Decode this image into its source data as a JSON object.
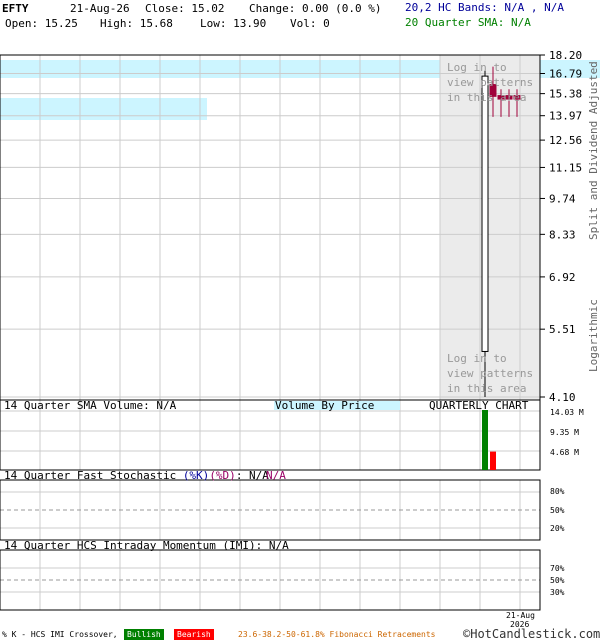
{
  "header": {
    "symbol": "EFTY",
    "date": "21-Aug-26",
    "close_text": "Close: 15.02",
    "change_text": "Change: 0.00 (0.0 %)",
    "open_text": "Open: 15.25",
    "high_text": "High: 15.68",
    "low_text": "Low: 13.90",
    "vol_text": "Vol: 0",
    "bands_text": "20,2 HC Bands: N/A , N/A",
    "sma_text": "20 Quarter SMA: N/A"
  },
  "side_labels": {
    "split": "Split and Dividend Adjusted",
    "log": "Logarithmic"
  },
  "patterns_text": [
    "Log in to",
    "view patterns",
    "in this area"
  ],
  "volume_panel": {
    "title": "14 Quarter SMA Volume: N/A",
    "vbp": "Volume By Price",
    "chart_label": "QUARTERLY CHART",
    "ticks": [
      "14.03 M",
      "9.35 M",
      "4.68 M"
    ]
  },
  "stoch_panel": {
    "title": "14 Quarter Fast Stochastic ",
    "k": "(%K)",
    "d": "(%D)",
    "vals": ": N/A",
    "vals2": "N/A",
    "ticks": [
      "80%",
      "50%",
      "20%"
    ]
  },
  "imi_panel": {
    "title": "14 Quarter HCS Intraday Momentum (IMI): N/A",
    "ticks": [
      "70%",
      "50%",
      "30%"
    ]
  },
  "footer": {
    "crossover": "% K - HCS IMI Crossover,",
    "bullish": "Bullish",
    "bearish": "Bearish",
    "fib": "23.6-38.2-50-61.8% Fibonacci Retracements",
    "copyright": "©HotCandlestick.com",
    "xdate1": "21-Aug",
    "xdate2": "2026"
  },
  "colors": {
    "up": "#ffffff",
    "down": "#a0003a",
    "vol_up": "#008000",
    "vol_down": "#ff0000",
    "band_fill": "#ccf5ff",
    "pattern_shade": "#ebebeb",
    "grid": "#cccccc",
    "blue_text": "#000099",
    "green_text": "#008000",
    "bullish_bg": "#008000",
    "bearish_bg": "#ff0000",
    "fib_text": "#cc6600"
  },
  "chart_data": {
    "type": "candlestick",
    "price_axis": {
      "scale": "log",
      "ticks": [
        "18.20",
        "16.79",
        "15.38",
        "13.97",
        "12.56",
        "11.15",
        "9.74",
        "8.33",
        "6.92",
        "5.51",
        "4.10"
      ]
    },
    "candles": [
      {
        "open": 5.0,
        "high": 17.0,
        "low": 4.1,
        "close": 16.6,
        "direction": "up"
      },
      {
        "open": 16.0,
        "high": 17.3,
        "low": 13.9,
        "close": 15.2,
        "direction": "down"
      },
      {
        "open": 15.25,
        "high": 15.68,
        "low": 13.9,
        "close": 15.02,
        "direction": "down"
      },
      {
        "open": 15.25,
        "high": 15.68,
        "low": 13.9,
        "close": 15.02,
        "direction": "down"
      },
      {
        "open": 15.25,
        "high": 15.68,
        "low": 13.9,
        "close": 15.02,
        "direction": "down"
      }
    ],
    "volume": [
      {
        "value": 14.03,
        "color": "green"
      },
      {
        "value": 4.3,
        "color": "red"
      }
    ]
  }
}
